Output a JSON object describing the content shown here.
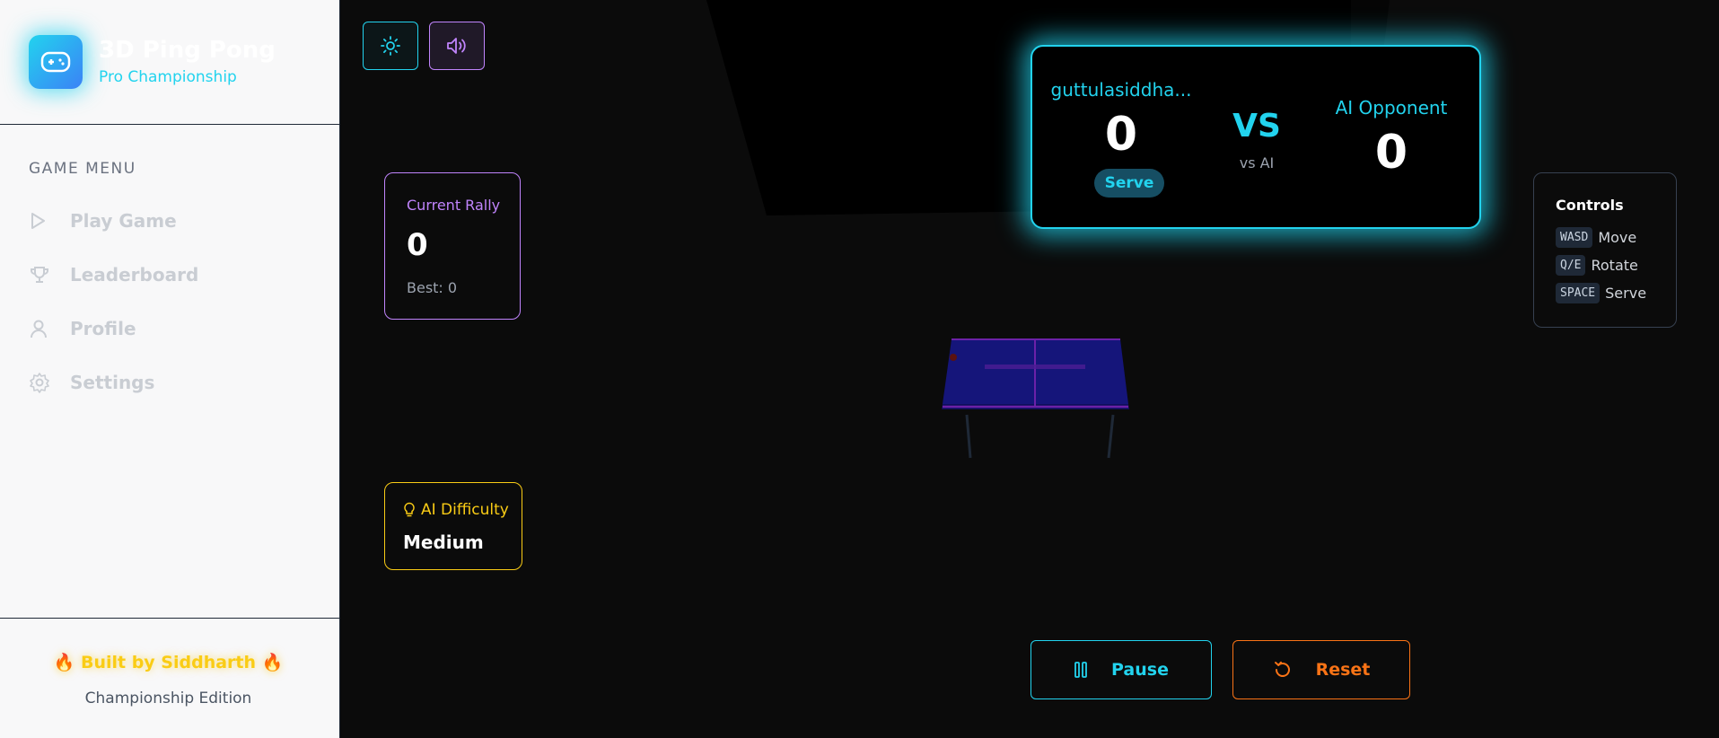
{
  "brand": {
    "title": "3D Ping Pong",
    "subtitle": "Pro Championship",
    "logo_icon": "gamepad-icon"
  },
  "menu": {
    "heading": "GAME MENU",
    "items": [
      {
        "label": "Play Game",
        "icon": "play-icon"
      },
      {
        "label": "Leaderboard",
        "icon": "trophy-icon"
      },
      {
        "label": "Profile",
        "icon": "user-icon"
      },
      {
        "label": "Settings",
        "icon": "gear-icon"
      }
    ]
  },
  "footer": {
    "credit": "🔥 Built by Siddharth 🔥",
    "edition": "Championship Edition"
  },
  "toolbar": {
    "theme_icon": "sun-icon",
    "sound_icon": "speaker-icon"
  },
  "scoreboard": {
    "player_name": "guttulasiddha...",
    "player_score": "0",
    "serve_label": "Serve",
    "vs": "VS",
    "vs_sub": "vs AI",
    "opponent_name": "AI Opponent",
    "opponent_score": "0"
  },
  "rally": {
    "title": "Current Rally",
    "value": "0",
    "best": "Best: 0"
  },
  "difficulty": {
    "title": "AI Difficulty",
    "value": "Medium"
  },
  "controls": {
    "title": "Controls",
    "rows": [
      {
        "key": "WASD",
        "action": "Move"
      },
      {
        "key": "Q/E",
        "action": "Rotate"
      },
      {
        "key": "SPACE",
        "action": "Serve"
      }
    ]
  },
  "actions": {
    "pause": "Pause",
    "reset": "Reset"
  },
  "colors": {
    "accent_cyan": "#22d3ee",
    "accent_purple": "#c084fc",
    "accent_yellow": "#facc15",
    "accent_orange": "#f97316",
    "table_blue": "#1a1a8c",
    "background": "#0b0b0b"
  }
}
